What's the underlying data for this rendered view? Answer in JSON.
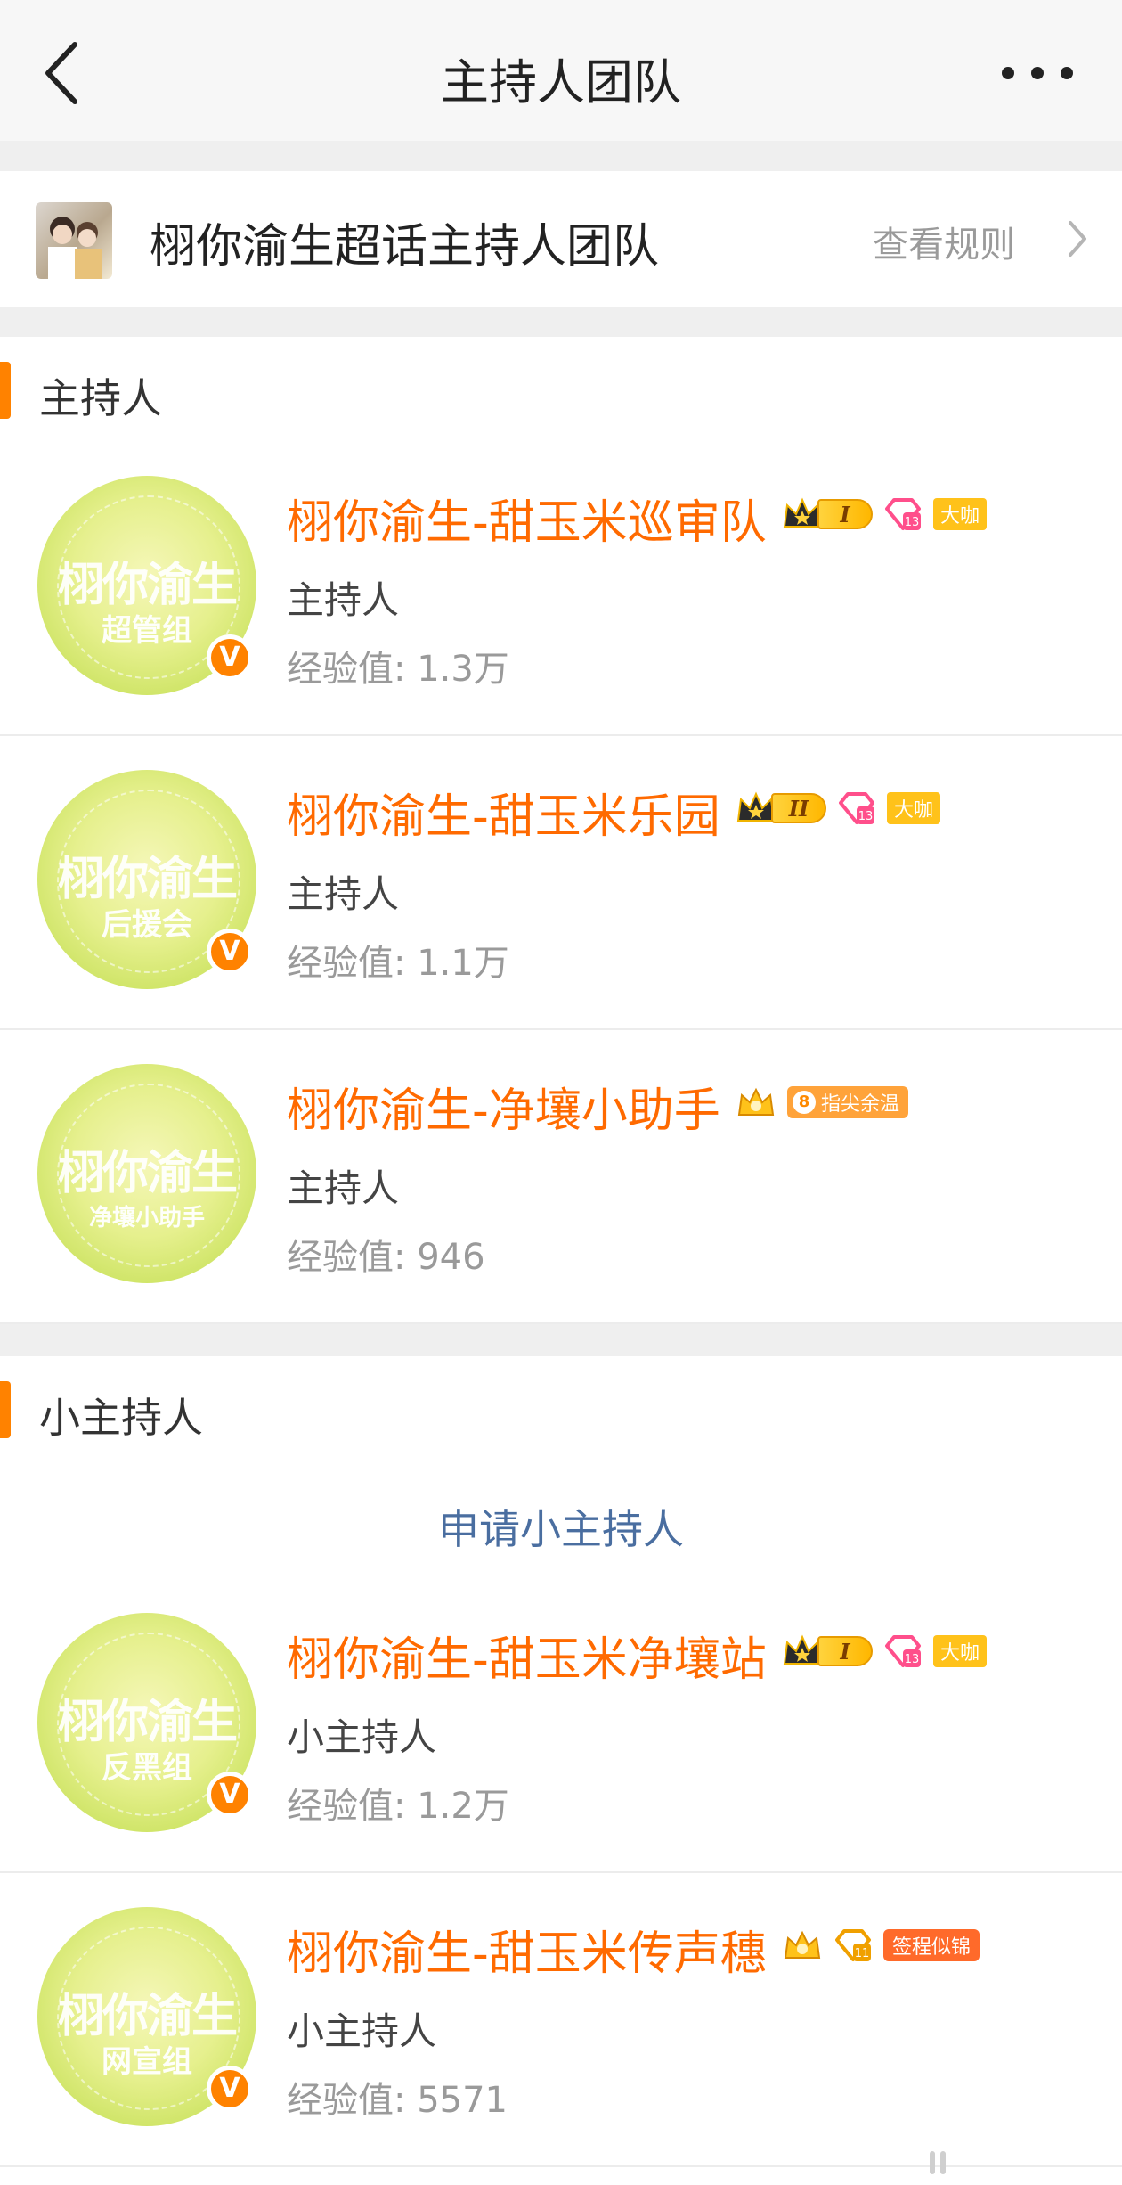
{
  "header": {
    "title": "主持人团队"
  },
  "team": {
    "name": "栩你渝生超话主持人团队",
    "rules_label": "查看规则"
  },
  "sections": [
    {
      "title": "主持人",
      "members": [
        {
          "name": "栩你渝生-甜玉米巡审队",
          "role": "主持人",
          "exp": "经验值: 1.3万",
          "avatar_line1": "栩你渝生",
          "avatar_line2": "超管组",
          "crown_level": "I",
          "tag": "大咖"
        },
        {
          "name": "栩你渝生-甜玉米乐园",
          "role": "主持人",
          "exp": "经验值: 1.1万",
          "avatar_line1": "栩你渝生",
          "avatar_line2": "后援会",
          "crown_level": "II",
          "tag": "大咖"
        },
        {
          "name": "栩你渝生-净壤小助手",
          "role": "主持人",
          "exp": "经验值: 946",
          "avatar_line1": "栩你渝生",
          "avatar_line2": "净壤小助手",
          "tag_num": "8",
          "tag": "指尖余温"
        }
      ]
    },
    {
      "title": "小主持人",
      "apply_label": "申请小主持人",
      "members": [
        {
          "name": "栩你渝生-甜玉米净壤站",
          "role": "小主持人",
          "exp": "经验值: 1.2万",
          "avatar_line1": "栩你渝生",
          "avatar_line2": "反黑组",
          "crown_level": "I",
          "tag": "大咖"
        },
        {
          "name": "栩你渝生-甜玉米传声穗",
          "role": "小主持人",
          "exp": "经验值: 5571",
          "avatar_line1": "栩你渝生",
          "avatar_line2": "网宣组",
          "tag": "签程似锦"
        }
      ]
    }
  ],
  "colors": {
    "accent": "#ff8200",
    "name": "#ff6a00",
    "link": "#4a6ea0"
  },
  "icons": {
    "back": "chevron-left-icon",
    "more": "more-horizontal-icon",
    "verified": "verified-v-icon"
  }
}
